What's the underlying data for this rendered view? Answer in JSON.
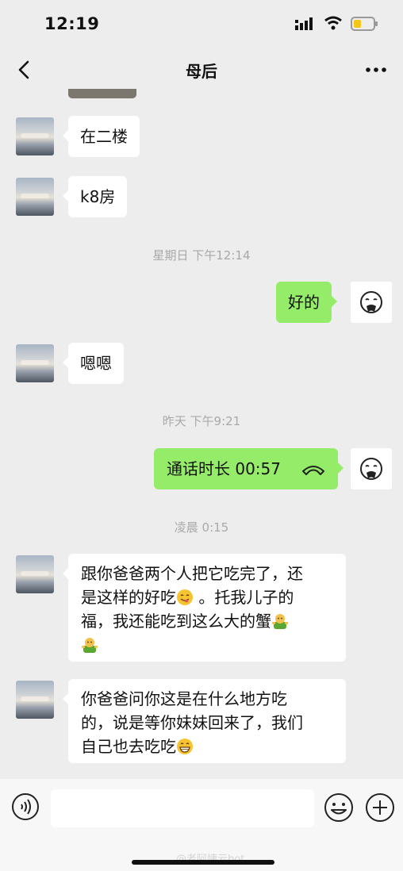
{
  "status": {
    "time": "12:19"
  },
  "header": {
    "title": "母后"
  },
  "messages": [
    {
      "text": "在二楼"
    },
    {
      "text": "k8房"
    },
    {
      "text": "好的"
    },
    {
      "text": "嗯嗯"
    },
    {
      "call_label": "通话时长 00:57"
    },
    {
      "text_line1": "跟你爸爸两个人把它吃完了，还",
      "text_line2a": "是这样的好吃",
      "text_line2b": " 。托我儿子的",
      "text_line3": "福，我还能吃到这么大的蟹"
    },
    {
      "text_line1": "你爸爸问你这是在什么地方吃",
      "text_line2": "的，说是等你妹妹回来了，我们",
      "text_line3": "自己也去吃吃"
    }
  ],
  "timestamps": [
    "星期日 下午12:14",
    "昨天 下午9:21",
    "凌晨 0:15"
  ],
  "input": {
    "placeholder": ""
  },
  "watermark": "@老阿姨云bot",
  "colors": {
    "background": "#ededed",
    "sent_bubble": "#95ec69",
    "received_bubble": "#ffffff",
    "timestamp": "#a9a9a9"
  },
  "icons": [
    "back-chevron-icon",
    "more-dots-icon",
    "voice-icon",
    "emoji-icon",
    "plus-icon",
    "hang-up-phone-icon",
    "face-emoji-icon",
    "yum-emoji-icon",
    "sticker-emoji-icon",
    "grin-emoji-icon"
  ]
}
